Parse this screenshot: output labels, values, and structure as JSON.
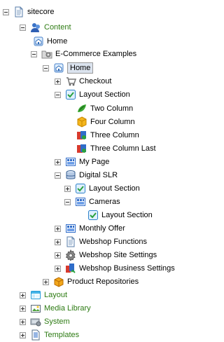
{
  "tree": {
    "sitecore": "sitecore",
    "content": "Content",
    "home_top": "Home",
    "ecommerce_examples": "E-Commerce Examples",
    "home": "Home",
    "checkout": "Checkout",
    "layout_section": "Layout Section",
    "two_column": "Two Column",
    "four_column": "Four Column",
    "three_column": "Three Column",
    "three_column_last": "Three Column Last",
    "my_page": "My Page",
    "digital_slr": "Digital SLR",
    "dslr_layout_section": "Layout Section",
    "cameras": "Cameras",
    "cameras_layout_section": "Layout Section",
    "monthly_offer": "Monthly Offer",
    "webshop_functions": "Webshop Functions",
    "webshop_site_settings": "Webshop Site Settings",
    "webshop_business_settings": "Webshop Business Settings",
    "product_repositories": "Product Repositories",
    "layout": "Layout",
    "media_library": "Media Library",
    "system": "System",
    "templates": "Templates"
  },
  "icons": {
    "sitecore": "document-icon",
    "content": "content-people-icon",
    "home": "home-icon",
    "ecommerce_examples": "folder-gears-icon",
    "checkout": "cart-icon",
    "layout_section": "layout-section-icon",
    "two_column": "two-column-icon",
    "four_column": "cube-icon",
    "three_column": "three-column-icon",
    "my_page": "grid-page-icon",
    "digital_slr": "database-icon",
    "cameras": "grid-page-icon",
    "monthly_offer": "grid-page-icon",
    "webshop_functions": "document-icon",
    "webshop_site_settings": "settings-gear-icon",
    "webshop_business_settings": "business-settings-icon",
    "product_repositories": "box-icon",
    "layout": "layout-icon",
    "media_library": "media-library-icon",
    "system": "system-icon",
    "templates": "templates-icon"
  },
  "colors": {
    "green_text": "#2d7b13",
    "selected_background": "#dbe3ee",
    "toggle_border": "#9a9a9a"
  }
}
